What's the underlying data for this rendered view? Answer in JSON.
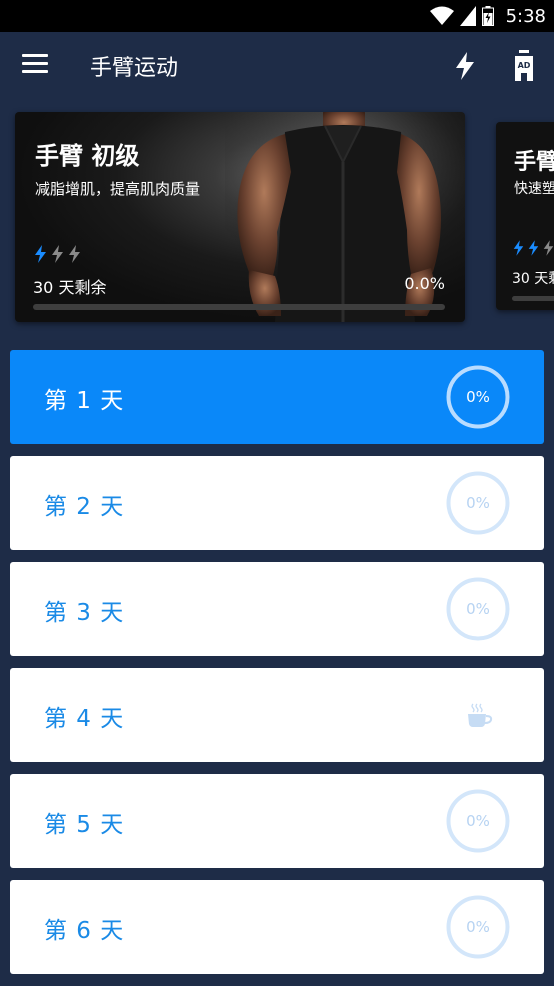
{
  "status_bar": {
    "time": "5:38"
  },
  "app_bar": {
    "title": "手臂运动"
  },
  "plans": [
    {
      "title": "手臂 初级",
      "subtitle": "减脂增肌，提高肌肉质量",
      "days_left": "30 天剩余",
      "percent": "0.0%",
      "progress": 0,
      "level_filled": 1,
      "level_total": 3
    },
    {
      "title": "手臂",
      "subtitle": "快速塑",
      "days_left": "30 天剩",
      "level_filled": 2,
      "level_total": 3
    }
  ],
  "days": [
    {
      "label": "第 1 天",
      "progress_text": "0%",
      "active": true,
      "rest": false
    },
    {
      "label": "第 2 天",
      "progress_text": "0%",
      "active": false,
      "rest": false
    },
    {
      "label": "第 3 天",
      "progress_text": "0%",
      "active": false,
      "rest": false
    },
    {
      "label": "第 4 天",
      "progress_text": "",
      "active": false,
      "rest": true
    },
    {
      "label": "第 5 天",
      "progress_text": "0%",
      "active": false,
      "rest": false
    },
    {
      "label": "第 6 天",
      "progress_text": "0%",
      "active": false,
      "rest": false
    }
  ],
  "colors": {
    "accent": "#0a88f9",
    "background": "#1e2c47",
    "ring_inactive": "#d3e6fa"
  },
  "icons": [
    "menu-icon",
    "bolt-icon",
    "ad-icon",
    "wifi-icon",
    "signal-icon",
    "battery-icon",
    "coffee-cup-icon"
  ]
}
